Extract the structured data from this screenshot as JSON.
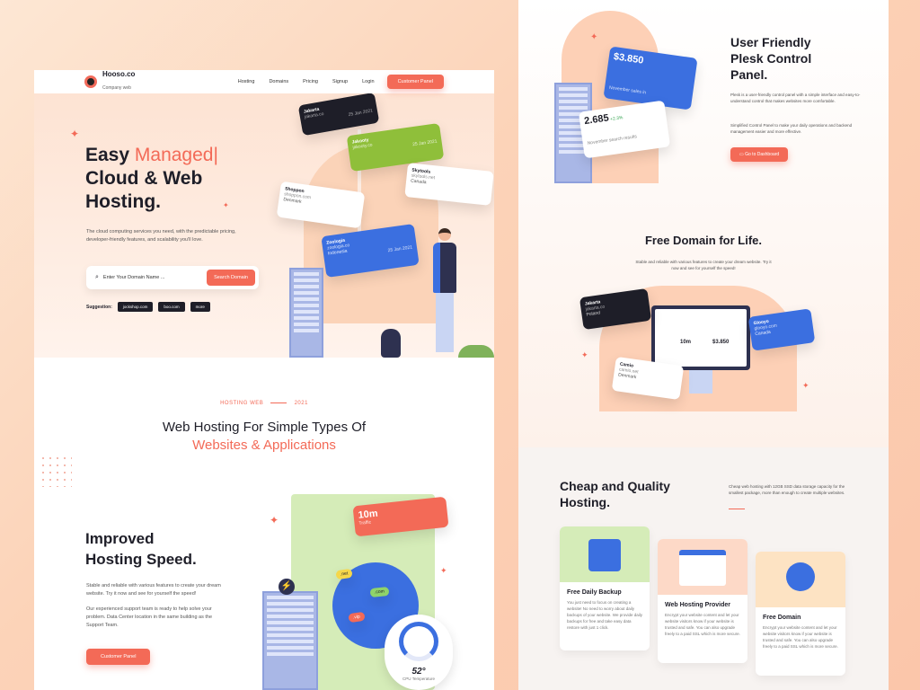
{
  "nav": {
    "brand": "Hooso.co",
    "brand_sub": "Company web",
    "links": [
      "Hosting",
      "Domains",
      "Pricing",
      "Signup",
      "Login"
    ],
    "cta": "Customer Panel"
  },
  "hero": {
    "title_line1": "Easy",
    "title_accent": "Managed",
    "title_line2": "Cloud & Web",
    "title_line3": "Hosting.",
    "description": "The cloud computing services you need, with the predictable pricing, developer-friendly features, and scalability you'll love.",
    "search_placeholder": "Enter Your Domain Name ...",
    "search_button": "Search Domain",
    "suggestion_label": "Suggestion:",
    "suggestions": [
      "jockshop.com",
      "boo.com",
      "more"
    ]
  },
  "hero_cards": [
    {
      "name": "Jakarta",
      "domain": "jakarta.co",
      "country": "Poland",
      "date": "25 Jan 2021"
    },
    {
      "name": "Jakooty",
      "domain": "jakooty.co",
      "country": "Japan",
      "date": "25 Jan 2021"
    },
    {
      "name": "Shoppon",
      "domain": "shoppon.com",
      "country": "Denmark",
      "date": "25 Jan 2021"
    },
    {
      "name": "Skytools",
      "domain": "skytools.net",
      "country": "Canada",
      "date": "25 Jan 2021"
    },
    {
      "name": "Zoologia",
      "domain": "zoologia.co",
      "country": "Indonesia",
      "date": "25 Jan 2021"
    }
  ],
  "section2": {
    "tag": "HOSTING WEB",
    "year": "2021",
    "title_line1": "Web Hosting For Simple Types Of",
    "title_line2": "Websites & Applications"
  },
  "speed": {
    "title_line1": "Improved",
    "title_line2": "Hosting Speed.",
    "p1": "Stable and reliable with various features to create your dream website. Try it now and see for yourself the speed!",
    "p2": "Our experienced support team is ready to help solve your problem. Data Center location in the same building as the Support Team.",
    "button": "Customer Panel",
    "traffic_value": "10m",
    "traffic_label": "Traffic",
    "tags": [
      ".net",
      ".com",
      ".vip"
    ],
    "temp_value": "52°",
    "temp_label": "CPU Temperature"
  },
  "plesk": {
    "title_line1": "User Friendly",
    "title_line2": "Plesk Control",
    "title_line3": "Panel.",
    "p1": "Plesk is a user-friendly control panel with a simple interface and easy-to-understand control that makes websites more comfortable.",
    "p2": "Simplified Control Panel to make your daily operations and backend management easier and more effective.",
    "button": "Go to Dashboard",
    "card1_value": "$3.850",
    "card1_label": "November sales in",
    "card2_value": "2.685",
    "card2_delta": "+2.3%",
    "card2_label": "November search results"
  },
  "free_domain": {
    "title": "Free Domain for Life.",
    "desc": "Stable and reliable with various features to create your dream website. Try it now and see for yourself the speed!",
    "monitor_v1": "10m",
    "monitor_v2": "$3.850",
    "cards": [
      {
        "name": "Jakarta",
        "domain": "jakarta.co",
        "country": "Poland",
        "date": "25 Jan 2021"
      },
      {
        "name": "Glooyo",
        "domain": "glooyo.com",
        "country": "Canada",
        "date": "25 Jan 2021"
      },
      {
        "name": "Camio",
        "domain": "camio.net",
        "country": "Denmark",
        "date": "25 Jan 2021"
      }
    ]
  },
  "cheap": {
    "title_line1": "Cheap and Quality",
    "title_line2": "Hosting.",
    "desc": "Cheap web hosting with 12GB SSD data storage capacity for the smallest package, more than enough to create multiple websites.",
    "features": [
      {
        "title": "Free Daily Backup",
        "desc": "You just need to focus on creating a website! No need to worry about daily backups of your website. We provide daily backups for free and take easy data restore with just 1 click."
      },
      {
        "title": "Web Hosting Provider",
        "desc": "Encrypt your website content and let your website visitors know if your website is trusted and safe. You can also upgrade freely to a paid SSL which is more secure."
      },
      {
        "title": "Free Domain",
        "desc": "Encrypt your website content and let your website visitors know if your website is trusted and safe. You can also upgrade freely to a paid SSL which is more secure."
      }
    ]
  },
  "colors": {
    "accent": "#f36a57",
    "dark": "#1e1e28",
    "blue": "#3b6fe0",
    "green": "#8fbf3a"
  }
}
